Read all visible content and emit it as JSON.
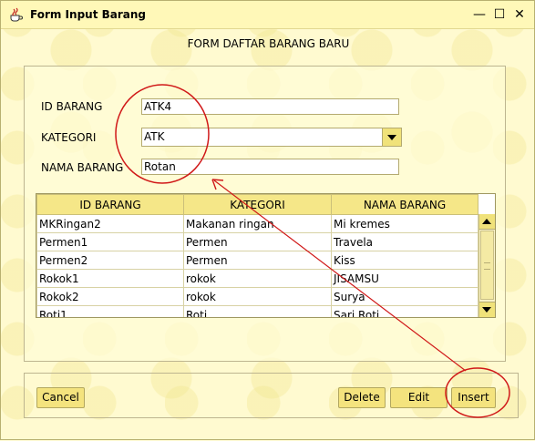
{
  "window": {
    "title": "Form Input Barang",
    "controls": [
      "minimize-icon",
      "maximize-icon",
      "close-icon"
    ],
    "min_glyph": "—",
    "max_glyph": "☐",
    "close_glyph": "✕"
  },
  "form": {
    "heading": "FORM DAFTAR BARANG BARU",
    "id_label": "ID BARANG",
    "id_value": "ATK4",
    "kategori_label": "KATEGORI",
    "kategori_value": "ATK",
    "nama_label": "NAMA BARANG",
    "nama_value": "Rotan"
  },
  "table": {
    "columns": [
      "ID BARANG",
      "KATEGORI",
      "NAMA BARANG"
    ],
    "rows": [
      [
        "MKRingan2",
        "Makanan ringan",
        "Mi kremes"
      ],
      [
        "Permen1",
        "Permen",
        "Travela"
      ],
      [
        "Permen2",
        "Permen",
        "Kiss"
      ],
      [
        "Rokok1",
        "rokok",
        "JISAMSU"
      ],
      [
        "Rokok2",
        "rokok",
        "Surya"
      ],
      [
        "Roti1",
        "Roti",
        "Sari Roti"
      ]
    ]
  },
  "buttons": {
    "cancel": "Cancel",
    "delete": "Delete",
    "edit": "Edit",
    "insert": "Insert"
  },
  "colors": {
    "annotation": "#d01818",
    "button_bg": "#f4e37e",
    "header_bg": "#f5e788"
  }
}
